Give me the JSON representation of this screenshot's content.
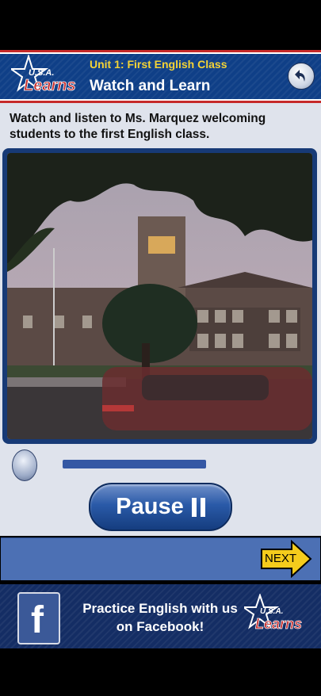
{
  "header": {
    "unit_title": "Unit 1: First English Class",
    "screen_title": "Watch and Learn",
    "logo_text": "U.S.A. Learns",
    "back_icon": "back-arrow-icon"
  },
  "main": {
    "instruction": "Watch and listen to Ms. Marquez welcoming students to the first English class.",
    "progress": 1.0,
    "pause_label": "Pause",
    "pause_icon": "pause-icon"
  },
  "nav": {
    "next_label": "NEXT"
  },
  "footer": {
    "facebook_text": "Practice English with us on Facebook!",
    "facebook_icon": "facebook-icon",
    "logo_text": "U.S.A. Learns"
  },
  "colors": {
    "header_blue": "#0f3f87",
    "accent_red": "#c62a2a",
    "unit_yellow": "#f4d335",
    "nav_blue": "#4c70b4",
    "next_yellow": "#f5cc1c"
  }
}
